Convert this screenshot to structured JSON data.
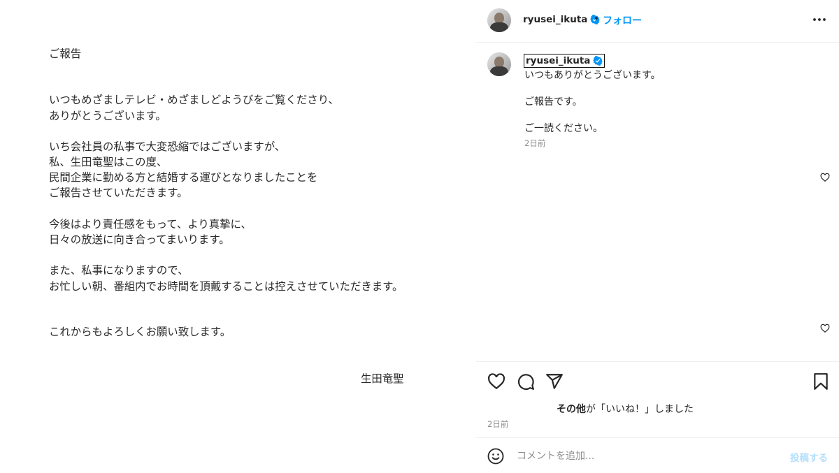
{
  "post_image": {
    "title": "ご報告",
    "lines": [
      "いつもめざましテレビ・めざましどようびをご覧くださり、",
      "ありがとうございます。",
      "いち会社員の私事で大変恐縮ではございますが、",
      "私、生田竜聖はこの度、",
      "民間企業に勤める方と結婚する運びとなりましたことを",
      "ご報告させていただきます。",
      "今後はより責任感をもって、より真摯に、",
      "日々の放送に向き合ってまいります。",
      "また、私事になりますので、",
      "お忙しい朝、番組内でお時間を頂戴することは控えさせていただきます。",
      "これからもよろしくお願い致します。"
    ],
    "signature": "生田竜聖"
  },
  "header": {
    "username": "ryusei_ikuta",
    "separator": "•",
    "follow_label": "フォロー",
    "verified_icon": "verified-badge-icon",
    "more_icon": "more-options-icon"
  },
  "caption": {
    "username": "ryusei_ikuta",
    "lines": [
      "いつもありがとうございます。",
      "ご報告です。",
      "ご一読ください。"
    ],
    "time": "2日前"
  },
  "actions": {
    "icons": [
      "heart-icon",
      "comment-icon",
      "share-icon",
      "bookmark-icon"
    ],
    "likes_bold": "その他",
    "likes_rest": "が「いいね！」しました",
    "time": "2日前"
  },
  "comment": {
    "placeholder": "コメントを追加...",
    "post_label": "投稿する",
    "emoji_icon": "emoji-icon"
  },
  "colors": {
    "accent": "#0095f6",
    "verified": "#0095f6",
    "muted": "#8e8e8e",
    "post_disabled": "#b2dffc"
  }
}
